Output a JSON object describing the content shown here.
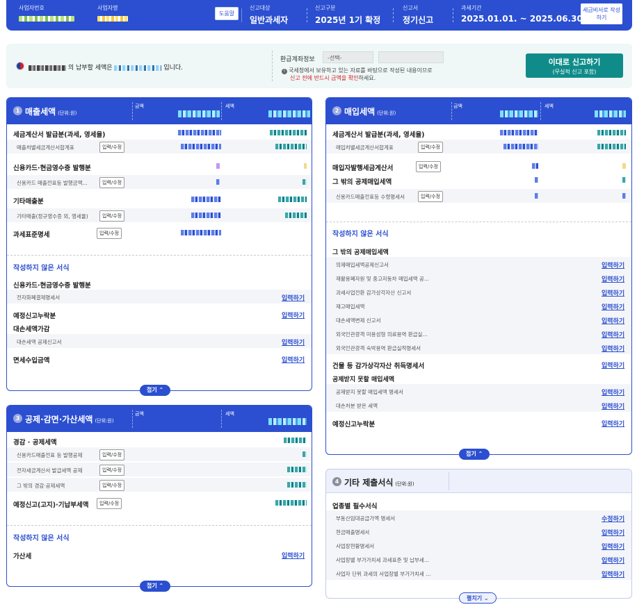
{
  "header": {
    "biz_no_label": "사업자번호",
    "biz_name_label": "사업자명",
    "help_label": "도움말",
    "target_label": "신고대상",
    "target_value": "일반과세자",
    "type_label": "신고구분",
    "type_value": "2025년 1기 확정",
    "form_label": "신고서",
    "form_value": "정기신고",
    "period_label": "과세기간",
    "period_value": "2025.01.01. ~ 2025.06.30.",
    "side_button": "세금비서로 작성하기"
  },
  "notice": {
    "msg_mid": "의 납부할 세액은",
    "msg_end": "입니다.",
    "refund_label": "환급계좌정보",
    "refund_select": "-선택-",
    "note_line1": "국세청에서 보유하고 있는 자료를 바탕으로 작성된 내용이므로",
    "note_line2_red": "신고 전에 반드시 금액을 확인",
    "note_line2_end": "하세요.",
    "submit_line1": "이대로 신고하기",
    "submit_line2": "(무실적 신고 포함)"
  },
  "common": {
    "amount_col": "금액",
    "tax_col": "세액",
    "unit": "(단위:원)",
    "edit": "입력/수정",
    "input_link": "입력하기",
    "modify_link": "수정하기",
    "unwritten": "작성하지 않은 서식",
    "fold": "접기",
    "unfold": "펼치기"
  },
  "sales": {
    "num": "1",
    "title": "매출세액",
    "rows": [
      "세금계산서 발급분(과세, 영세율)",
      "매출처별세금계산서합계표",
      "신용카드·현금영수증 발행분",
      "신용카드 매출전표등 발행금액...",
      "기타매출분",
      "기타매출(정규영수증 외, 영세율)",
      "과세표준명세"
    ],
    "unwritten_rows": [
      "신용카드·현금영수증 발행분",
      "전자화폐결제명세서",
      "예정신고누락분",
      "대손세액가감",
      "대손세액 공제신고서",
      "면세수입금액"
    ]
  },
  "purchase": {
    "num": "2",
    "title": "매입세액",
    "rows": [
      "세금계산서 발급분(과세, 영세율)",
      "매입처별세금계산서합계표",
      "매입자발행세금계산서",
      "그 밖의 공제매입세액",
      "신용카드매출전표등 수령명세서"
    ],
    "unwritten_group": "그 밖의 공제매입세액",
    "unwritten_rows": [
      "의제매입세액공제신고서",
      "재활용폐자원 및 중고자동차 매입세액 공...",
      "과세사업전환 감가상각자산 신고서",
      "재고매입세액",
      "대손세액변제 신고서",
      "외국인관광객 미용성형 의료용역 환급실...",
      "외국인관광객 숙박용역 환급실적명세서"
    ],
    "extra_rows": [
      "건물 등 감가상각자산 취득명세서",
      "공제받지 못할 매입세액",
      "공제받지 못할 매입세액 명세서",
      "대손처분 받은 세액",
      "예정신고누락분"
    ]
  },
  "deduction": {
    "num": "3",
    "title": "공제·감면·가산세액",
    "rows": [
      "경감 · 공제세액",
      "신용카드매출전표 등 발행공제",
      "전자세금계산서 발급세액 공제",
      "그 밖의 경감·공제세액",
      "예정신고(고지)·기납부세액"
    ],
    "unwritten_rows": [
      "가산세"
    ]
  },
  "other": {
    "num": "4",
    "title": "기타 제출서식",
    "group": "업종별 필수서식",
    "rows": [
      "부동산임대공급가액 명세서",
      "현금매출명세서",
      "사업장현황명세서",
      "사업장별 부가가치세 과세표준 및 납부세...",
      "사업자 단위 과세의 사업장별 부가가치세 ..."
    ]
  }
}
